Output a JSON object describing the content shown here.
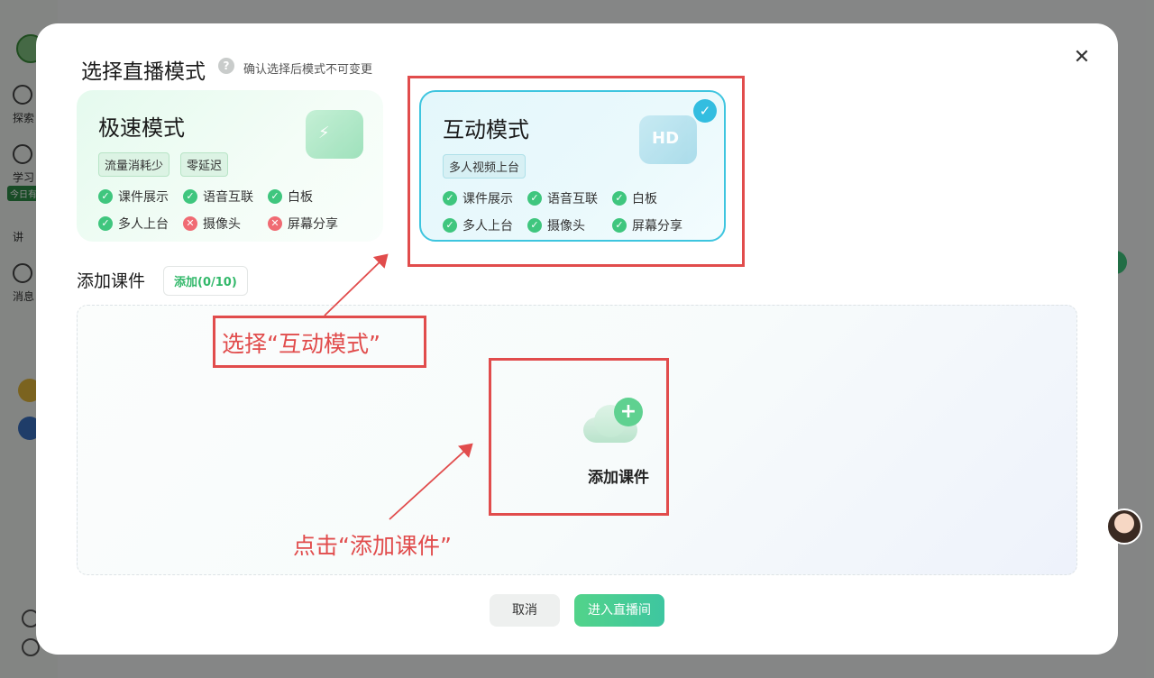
{
  "background": {
    "sidebar_items": [
      {
        "label": "探索"
      },
      {
        "label": "学习"
      },
      {
        "label": "讲"
      },
      {
        "label": "消息"
      }
    ],
    "today_tag": "今日有"
  },
  "modal": {
    "title": "选择直播模式",
    "help_icon": "?",
    "hint": "确认选择后模式不可变更",
    "close_icon": "✕",
    "modes": [
      {
        "title": "极速模式",
        "tags": [
          "流量消耗少",
          "零延迟"
        ],
        "features": [
          {
            "label": "课件展示",
            "enabled": true
          },
          {
            "label": "语音互联",
            "enabled": true
          },
          {
            "label": "白板",
            "enabled": true
          },
          {
            "label": "多人上台",
            "enabled": true
          },
          {
            "label": "摄像头",
            "enabled": false
          },
          {
            "label": "屏幕分享",
            "enabled": false
          }
        ],
        "selected": false
      },
      {
        "title": "互动模式",
        "tags": [
          "多人视频上台"
        ],
        "illus_text": "HD",
        "features": [
          {
            "label": "课件展示",
            "enabled": true
          },
          {
            "label": "语音互联",
            "enabled": true
          },
          {
            "label": "白板",
            "enabled": true
          },
          {
            "label": "多人上台",
            "enabled": true
          },
          {
            "label": "摄像头",
            "enabled": true
          },
          {
            "label": "屏幕分享",
            "enabled": true
          }
        ],
        "selected": true
      }
    ],
    "courseware": {
      "section_title": "添加课件",
      "count_label": "添加(0/10)",
      "add_label": "添加课件"
    },
    "buttons": {
      "cancel": "取消",
      "enter": "进入直播间"
    }
  },
  "annotations": {
    "select_mode": "选择“互动模式”",
    "click_add": "点击“添加课件”",
    "color": "#e14c4c"
  },
  "colors": {
    "accent_green": "#3fc67e",
    "accent_cyan": "#3ec5df",
    "error_red": "#f06b73"
  }
}
